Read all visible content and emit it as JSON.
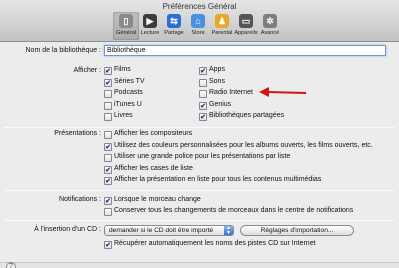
{
  "window": {
    "title": "Préférences Général"
  },
  "toolbar": [
    {
      "label": "Général",
      "icon": "switch-icon",
      "color": "#8a8a8a",
      "glyph": "▯"
    },
    {
      "label": "Lecture",
      "icon": "play-icon",
      "color": "#3b3b3b",
      "glyph": "▶"
    },
    {
      "label": "Partage",
      "icon": "share-icon",
      "color": "#2a6fd6",
      "glyph": "⇆"
    },
    {
      "label": "Store",
      "icon": "store-icon",
      "color": "#4a8fe0",
      "glyph": "⌂"
    },
    {
      "label": "Parental",
      "icon": "parental-icon",
      "color": "#e7a92a",
      "glyph": "♟"
    },
    {
      "label": "Appareils",
      "icon": "devices-icon",
      "color": "#555555",
      "glyph": "▭"
    },
    {
      "label": "Avancé",
      "icon": "gear-icon",
      "color": "#7d7d7d",
      "glyph": "✲"
    }
  ],
  "library": {
    "label": "Nom de la bibliothèque :",
    "value": "Bibliothèque"
  },
  "afficher": {
    "label": "Afficher :",
    "left": [
      {
        "label": "Films",
        "checked": true
      },
      {
        "label": "Séries TV",
        "checked": true
      },
      {
        "label": "Podcasts",
        "checked": false
      },
      {
        "label": "iTunes U",
        "checked": false
      },
      {
        "label": "Livres",
        "checked": false
      }
    ],
    "right": [
      {
        "label": "Apps",
        "checked": true
      },
      {
        "label": "Sons",
        "checked": false
      },
      {
        "label": "Radio Internet",
        "checked": false
      },
      {
        "label": "Genius",
        "checked": true
      },
      {
        "label": "Bibliothèques partagées",
        "checked": true
      }
    ]
  },
  "presentations": {
    "label": "Présentations :",
    "items": [
      {
        "label": "Afficher les compositeurs",
        "checked": false
      },
      {
        "label": "Utilisez des couleurs personnalisées pour les albums ouverts, les films ouverts, etc.",
        "checked": true
      },
      {
        "label": "Utiliser une grande police pour les présentations par liste",
        "checked": false
      },
      {
        "label": "Afficher les cases de liste",
        "checked": true
      },
      {
        "label": "Afficher la présentation en liste pour tous les contenus multimédias",
        "checked": true
      }
    ]
  },
  "notifications": {
    "label": "Notifications :",
    "items": [
      {
        "label": "Lorsque le morceau change",
        "checked": true
      },
      {
        "label": "Conserver tous les changements de morceaux dans le centre de notifications",
        "checked": false
      }
    ]
  },
  "cd": {
    "label": "À l'insertion d'un CD :",
    "select_value": "demander si le CD doit être importé",
    "import_button": "Réglages d'importation...",
    "auto_names": {
      "label": "Récupérer automatiquement les noms des pistes CD sur Internet",
      "checked": true
    }
  },
  "help": {
    "glyph": "?"
  },
  "annotation": {
    "color": "#d21414"
  }
}
